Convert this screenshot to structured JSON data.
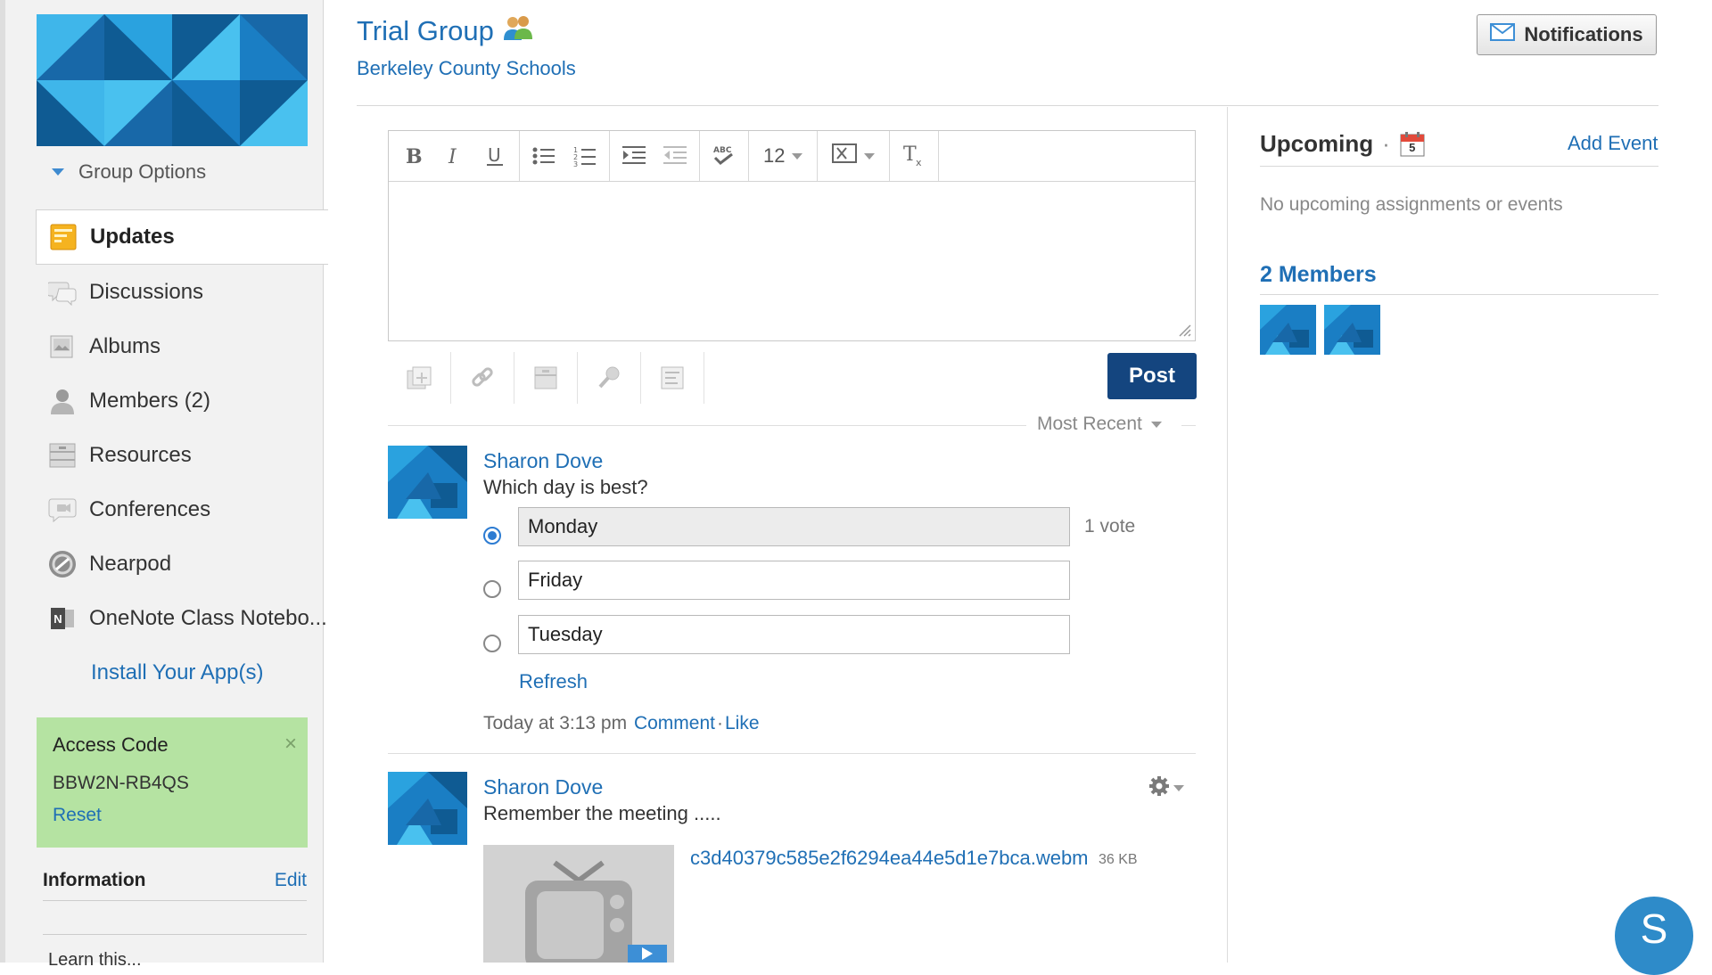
{
  "group": {
    "title": "Trial Group",
    "school": "Berkeley County Schools"
  },
  "header": {
    "notifications_label": "Notifications"
  },
  "sidebar": {
    "group_options": "Group Options",
    "items": [
      {
        "label": "Updates",
        "icon": "updates-icon",
        "active": true
      },
      {
        "label": "Discussions",
        "icon": "discussions-icon"
      },
      {
        "label": "Albums",
        "icon": "albums-icon"
      },
      {
        "label": "Members (2)",
        "icon": "members-icon"
      },
      {
        "label": "Resources",
        "icon": "resources-icon"
      },
      {
        "label": "Conferences",
        "icon": "conferences-icon"
      },
      {
        "label": "Nearpod",
        "icon": "nearpod-icon"
      },
      {
        "label": "OneNote Class Notebo...",
        "icon": "onenote-icon"
      }
    ],
    "install_apps": "Install Your App(s)",
    "access_code": {
      "title": "Access Code",
      "code": "BBW2N-RB4QS",
      "reset": "Reset",
      "close": "×"
    },
    "information": {
      "title": "Information",
      "edit": "Edit",
      "more": "Learn this..."
    }
  },
  "editor": {
    "font_size": "12",
    "toolbar": [
      "bold",
      "italic",
      "underline",
      "bulleted-list",
      "numbered-list",
      "indent",
      "outdent",
      "spell-check",
      "font-size",
      "insert",
      "clear-formatting"
    ],
    "attachments": [
      "add-file",
      "add-link",
      "add-resource",
      "record-audio",
      "add-poll"
    ],
    "post_label": "Post"
  },
  "feed": {
    "sort_label": "Most Recent",
    "posts": [
      {
        "author": "Sharon Dove",
        "text": "Which day is best?",
        "poll": [
          {
            "option": "Monday",
            "votes": "1 vote",
            "selected": true
          },
          {
            "option": "Friday",
            "votes": "",
            "selected": false
          },
          {
            "option": "Tuesday",
            "votes": "",
            "selected": false
          }
        ],
        "refresh": "Refresh",
        "time": "Today at 3:13 pm",
        "comment": "Comment",
        "separator": "·",
        "like": "Like"
      },
      {
        "author": "Sharon Dove",
        "text": "Remember the meeting .....",
        "attachment": {
          "filename": "c3d40379c585e2f6294ea44e5d1e7bca.webm",
          "size": "36 KB"
        }
      }
    ]
  },
  "upcoming": {
    "title": "Upcoming",
    "dot": "·",
    "calendar_day": "5",
    "add_event": "Add Event",
    "empty": "No upcoming assignments or events"
  },
  "members": {
    "title": "2 Members",
    "count": 2
  },
  "chat": {
    "initial": "S"
  },
  "colors": {
    "link": "#1f6fb5",
    "post_button": "#14457f",
    "access_bg": "#b5e3a2",
    "brand_blue": "#1a7ec4"
  }
}
